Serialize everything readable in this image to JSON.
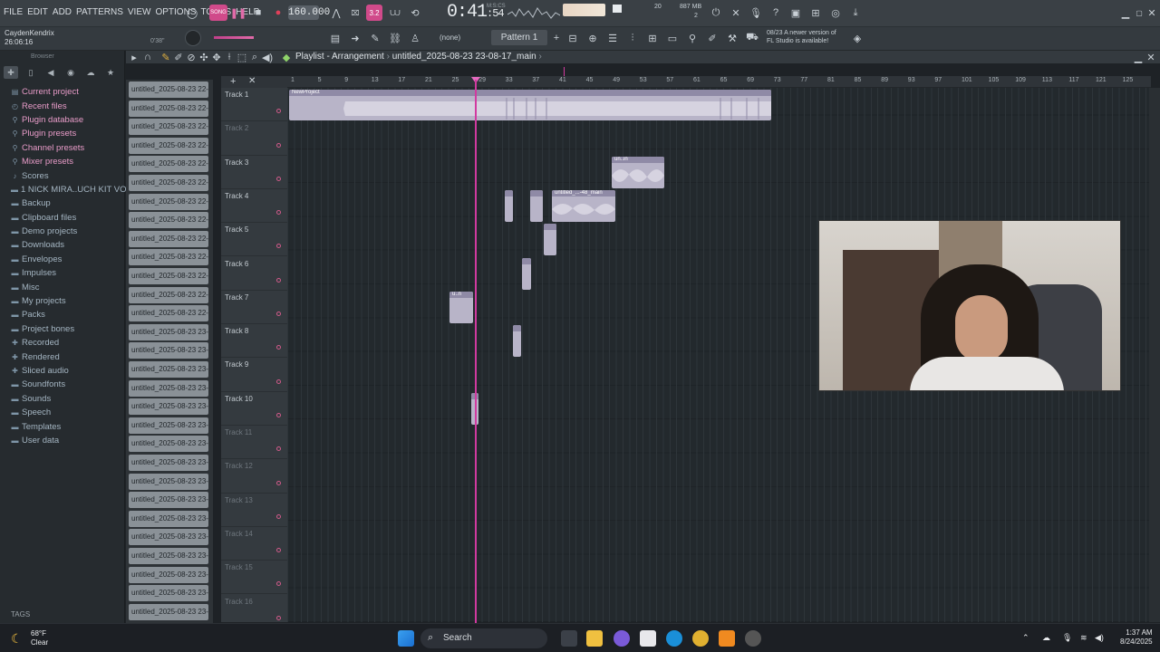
{
  "menu": [
    "FILE",
    "EDIT",
    "ADD",
    "PATTERNS",
    "VIEW",
    "OPTIONS",
    "TOOLS",
    "HELP"
  ],
  "transport": {
    "tempo": "160.000",
    "time_main": "0:41",
    "time_sub": ":54",
    "time_label": "M:S:CS",
    "cpu": "20",
    "mem": "887 MB",
    "voices": "2"
  },
  "user": {
    "name": "CaydenKendrix",
    "clock": "26:06:16",
    "zoom": "0'38\""
  },
  "pattern": {
    "selector": "Pattern 1",
    "channel": "(none)"
  },
  "update": {
    "line1": "08/23  A newer version of",
    "line2": "FL Studio is available!"
  },
  "browser": {
    "title": "Browser",
    "items": [
      {
        "label": "Current project",
        "icon": "project-icon",
        "selected": true
      },
      {
        "label": "Recent files",
        "icon": "recent-icon",
        "selected": true
      },
      {
        "label": "Plugin database",
        "icon": "plugin-icon",
        "selected": true
      },
      {
        "label": "Plugin presets",
        "icon": "plugin-icon",
        "selected": true
      },
      {
        "label": "Channel presets",
        "icon": "channel-icon",
        "selected": true
      },
      {
        "label": "Mixer presets",
        "icon": "mixer-icon",
        "selected": true
      },
      {
        "label": "Scores",
        "icon": "note-icon",
        "selected": false
      },
      {
        "label": "1 NICK MIRA..UCH KIT VOL 1",
        "icon": "folder-icon",
        "selected": false
      },
      {
        "label": "Backup",
        "icon": "folder-icon",
        "selected": false
      },
      {
        "label": "Clipboard files",
        "icon": "folder-icon",
        "selected": false
      },
      {
        "label": "Demo projects",
        "icon": "folder-icon",
        "selected": false
      },
      {
        "label": "Downloads",
        "icon": "folder-icon",
        "selected": false
      },
      {
        "label": "Envelopes",
        "icon": "folder-icon",
        "selected": false
      },
      {
        "label": "Impulses",
        "icon": "folder-icon",
        "selected": false
      },
      {
        "label": "Misc",
        "icon": "folder-icon",
        "selected": false
      },
      {
        "label": "My projects",
        "icon": "folder-icon",
        "selected": false
      },
      {
        "label": "Packs",
        "icon": "folder-icon",
        "selected": false
      },
      {
        "label": "Project bones",
        "icon": "folder-icon",
        "selected": false
      },
      {
        "label": "Recorded",
        "icon": "plus-icon",
        "selected": false
      },
      {
        "label": "Rendered",
        "icon": "plus-icon",
        "selected": false
      },
      {
        "label": "Sliced audio",
        "icon": "plus-icon",
        "selected": false
      },
      {
        "label": "Soundfonts",
        "icon": "folder-icon",
        "selected": false
      },
      {
        "label": "Sounds",
        "icon": "folder-icon",
        "selected": false
      },
      {
        "label": "Speech",
        "icon": "folder-icon",
        "selected": false
      },
      {
        "label": "Templates",
        "icon": "folder-icon",
        "selected": false
      },
      {
        "label": "User data",
        "icon": "folder-icon",
        "selected": false
      }
    ],
    "tags_label": "TAGS"
  },
  "picker": [
    "untitled_2025-08-23 22-",
    "untitled_2025-08-23 22-",
    "untitled_2025-08-23 22-",
    "untitled_2025-08-23 22-",
    "untitled_2025-08-23 22-",
    "untitled_2025-08-23 22-",
    "untitled_2025-08-23 22-",
    "untitled_2025-08-23 22-",
    "untitled_2025-08-23 22-",
    "untitled_2025-08-23 22-",
    "untitled_2025-08-23 22-",
    "untitled_2025-08-23 22-",
    "untitled_2025-08-23 22-",
    "untitled_2025-08-23 23-",
    "untitled_2025-08-23 23-",
    "untitled_2025-08-23 23-",
    "untitled_2025-08-23 23-",
    "untitled_2025-08-23 23-",
    "untitled_2025-08-23 23-",
    "untitled_2025-08-23 23-",
    "untitled_2025-08-23 23-",
    "untitled_2025-08-23 23-",
    "untitled_2025-08-23 23-",
    "untitled_2025-08-23 23-",
    "untitled_2025-08-23 23-",
    "untitled_2025-08-23 23-",
    "untitled_2025-08-23 23-",
    "untitled_2025-08-23 23-",
    "untitled_2025-08-23 23-"
  ],
  "playlist": {
    "title": "Playlist - Arrangement",
    "project": "untitled_2025-08-23 23-08-17_main",
    "ruler": [
      "1",
      "5",
      "9",
      "13",
      "17",
      "21",
      "25",
      "29",
      "33",
      "37",
      "41",
      "45",
      "49",
      "53",
      "57",
      "61",
      "65",
      "69",
      "73",
      "77",
      "81",
      "85",
      "89",
      "93",
      "97",
      "101",
      "105",
      "109",
      "113",
      "117",
      "121",
      "125"
    ],
    "tracks": [
      {
        "name": "Track 1",
        "active": true
      },
      {
        "name": "Track 2",
        "active": false
      },
      {
        "name": "Track 3",
        "active": true
      },
      {
        "name": "Track 4",
        "active": true
      },
      {
        "name": "Track 5",
        "active": true
      },
      {
        "name": "Track 6",
        "active": true
      },
      {
        "name": "Track 7",
        "active": true
      },
      {
        "name": "Track 8",
        "active": true
      },
      {
        "name": "Track 9",
        "active": true
      },
      {
        "name": "Track 10",
        "active": true
      },
      {
        "name": "Track 11",
        "active": false
      },
      {
        "name": "Track 12",
        "active": false
      },
      {
        "name": "Track 13",
        "active": false
      },
      {
        "name": "Track 14",
        "active": false
      },
      {
        "name": "Track 15",
        "active": false
      },
      {
        "name": "Track 16",
        "active": false
      }
    ],
    "clip_labels": {
      "main": "NewProject",
      "t3": "un..in",
      "t4": "untitled_...-48_main",
      "t7": "u..n"
    }
  },
  "taskbar": {
    "temp": "68°F",
    "weather": "Clear",
    "search": "Search",
    "time": "1:37 AM",
    "date": "8/24/2025"
  }
}
